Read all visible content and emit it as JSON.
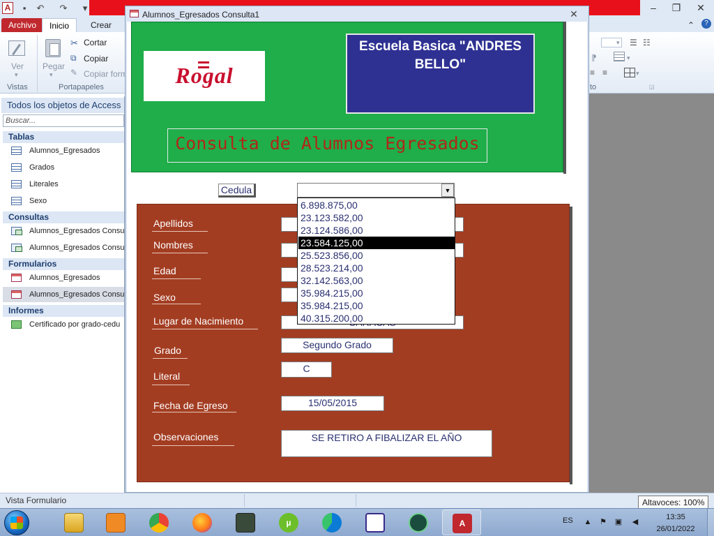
{
  "window": {
    "form_title": "Alumnos_Egresados Consulta1"
  },
  "ribbon": {
    "tabs": [
      {
        "label": "Archivo"
      },
      {
        "label": "Inicio"
      },
      {
        "label": "Crear"
      }
    ],
    "ver_label": "Ver",
    "pegar_label": "Pegar",
    "cortar_label": "Cortar",
    "copiar_label": "Copiar",
    "copiar_formato_label": "Copiar form",
    "group_vistas": "Vistas",
    "group_portapapeles": "Portapapeles",
    "group_right_partial": "to"
  },
  "nav": {
    "header": "Todos los objetos de Access",
    "search_placeholder": "Buscar...",
    "groups": [
      {
        "label": "Tablas",
        "items": [
          "Alumnos_Egresados",
          "Grados",
          "Literales",
          "Sexo"
        ]
      },
      {
        "label": "Consultas",
        "items": [
          "Alumnos_Egresados Consu",
          "Alumnos_Egresados Consu"
        ]
      },
      {
        "label": "Formularios",
        "items": [
          "Alumnos_Egresados",
          "Alumnos_Egresados Consu"
        ]
      },
      {
        "label": "Informes",
        "items": [
          "Certificado por grado-cedu"
        ]
      }
    ]
  },
  "form": {
    "logo": "Rogal",
    "school_name": "Escuela Basica \"ANDRES BELLO\"",
    "consulta_title": "Consulta de Alumnos Egresados",
    "cedula_label": "Cedula",
    "cedula_value": "",
    "fields": {
      "apellidos": {
        "label": "Apellidos",
        "value": ""
      },
      "nombres": {
        "label": "Nombres",
        "value": ""
      },
      "edad": {
        "label": "Edad",
        "value": ""
      },
      "sexo": {
        "label": "Sexo",
        "value": ""
      },
      "lugar": {
        "label": "Lugar de Nacimiento",
        "value": "CARACAS"
      },
      "grado": {
        "label": "Grado",
        "value": "Segundo Grado"
      },
      "literal": {
        "label": "Literal",
        "value": "C"
      },
      "fecha": {
        "label": "Fecha de Egreso",
        "value": "15/05/2015"
      },
      "observaciones": {
        "label": "Observaciones",
        "value": "SE RETIRO A FIBALIZAR EL AÑO"
      }
    },
    "dropdown_options": [
      "6.898.875,00",
      "23.123.582,00",
      "23.124.586,00",
      "23.584.125,00",
      "25.523.856,00",
      "28.523.214,00",
      "32.142.563,00",
      "35.984.215,00",
      "35.984.215,00",
      "40.315.200,00"
    ],
    "dropdown_selected_index": 3
  },
  "status": {
    "text": "Vista Formulario",
    "tooltip": "Altavoces: 100%"
  },
  "taskbar": {
    "apps": [
      "explorer",
      "media-player",
      "chrome",
      "firefox",
      "task-manager",
      "utorrent",
      "edge",
      "app-network",
      "app-check",
      "access"
    ],
    "language": "ES",
    "time": "13:35",
    "date": "26/01/2022"
  },
  "colors": {
    "header_green": "#1fae4a",
    "school_box": "#2e3192",
    "detail_panel": "#a33d22",
    "title_red": "#b02818",
    "redbar": "#e8101a"
  }
}
